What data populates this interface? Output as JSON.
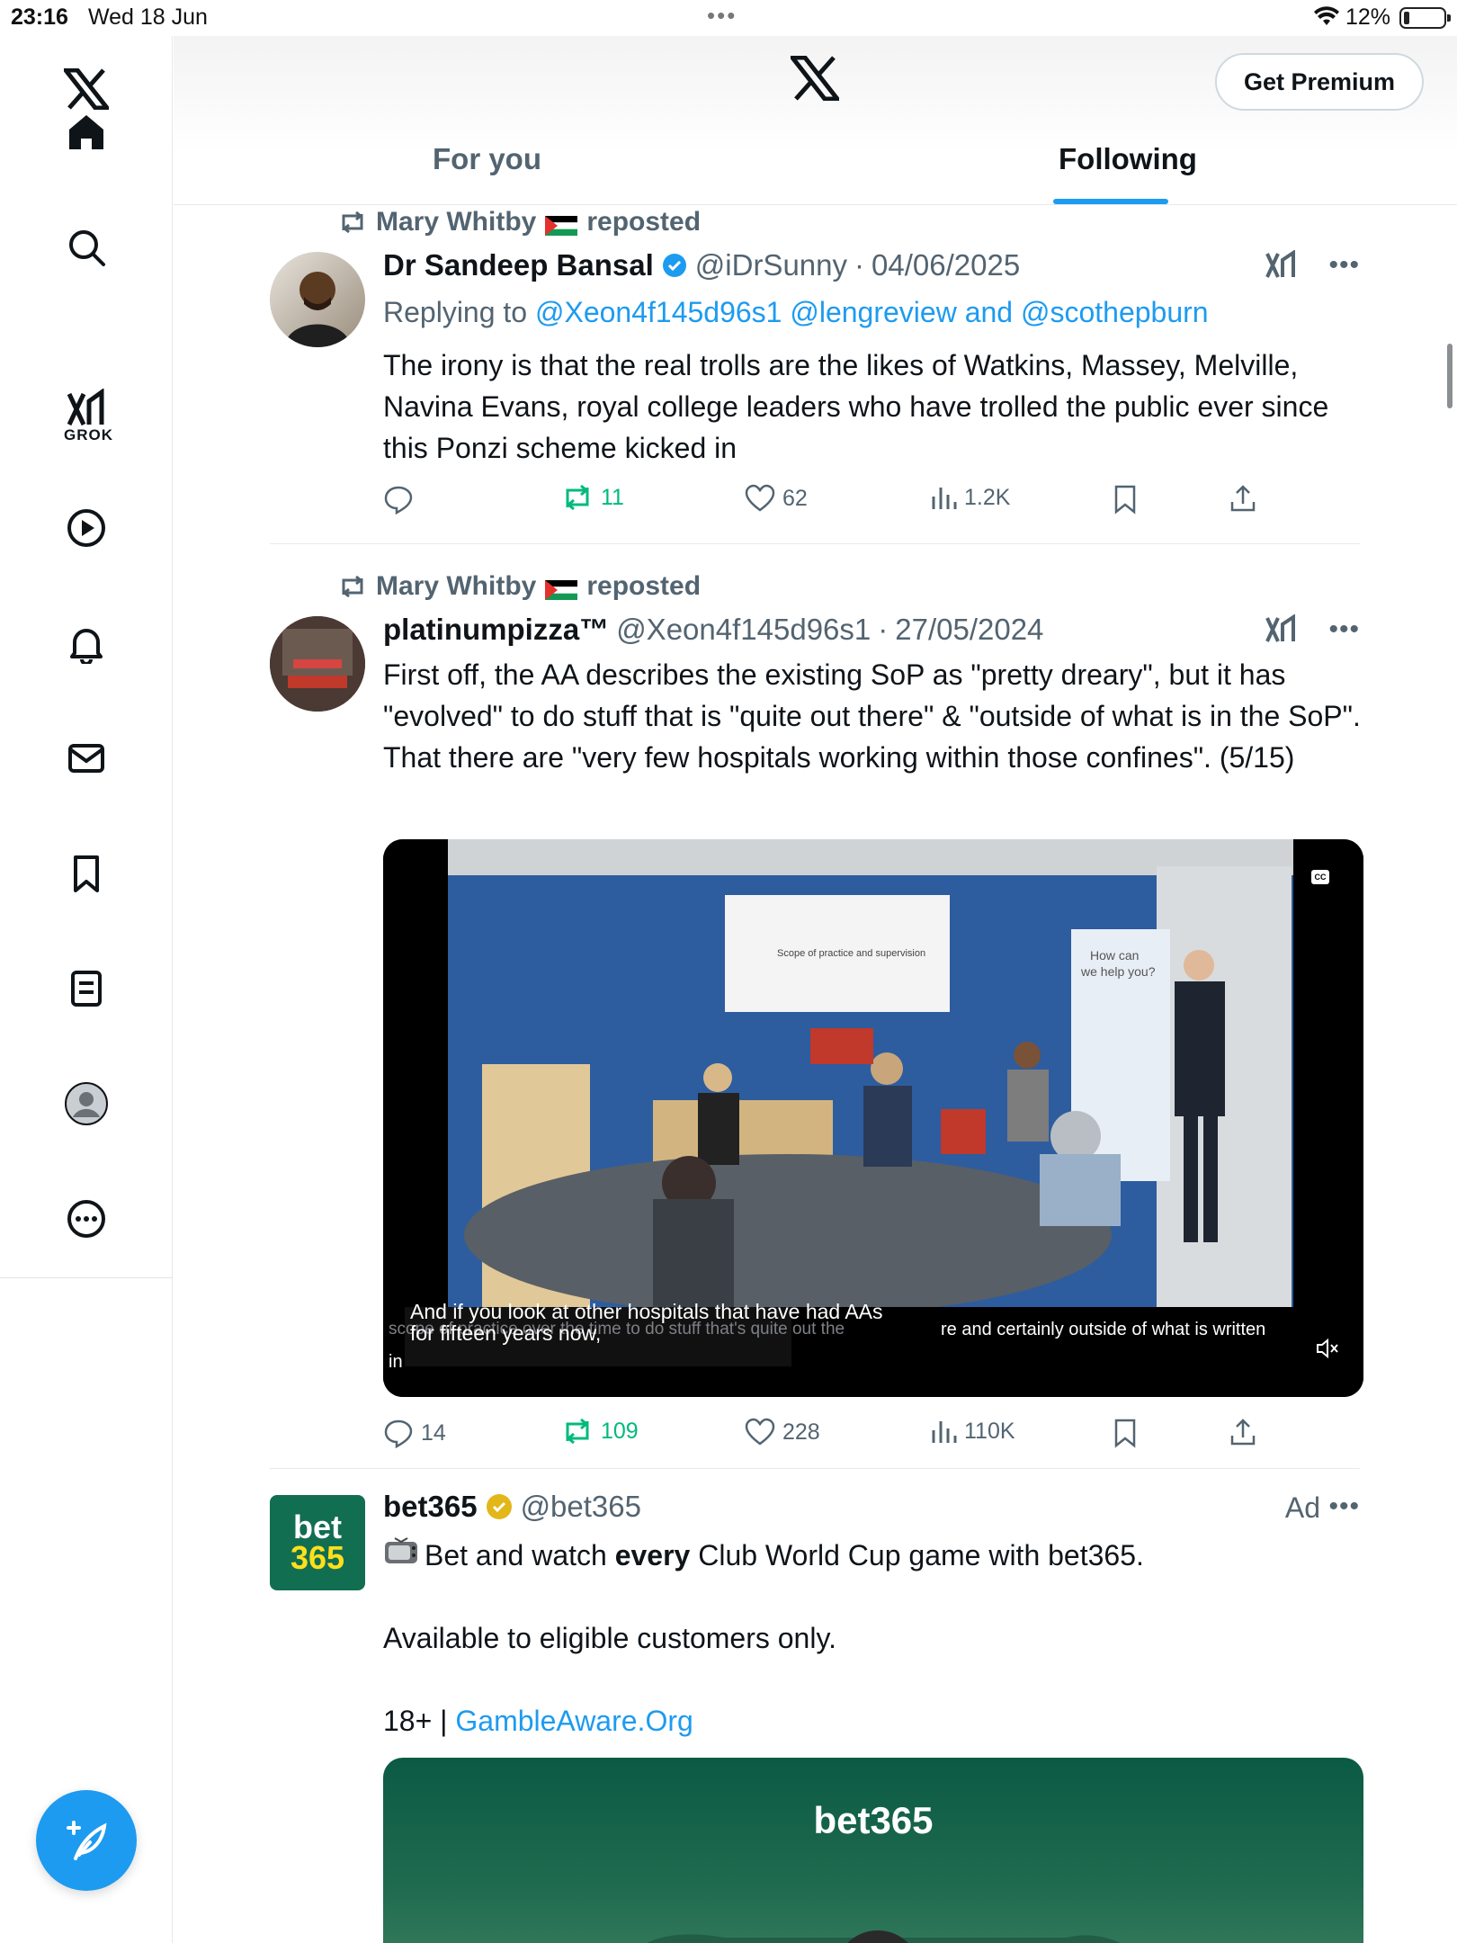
{
  "status_bar": {
    "time": "23:16",
    "date": "Wed 18 Jun",
    "battery": "12%"
  },
  "header": {
    "premium_label": "Get Premium",
    "tabs": [
      {
        "label": "For you"
      },
      {
        "label": "Following"
      }
    ]
  },
  "sidebar": {
    "grok_label": "GROK"
  },
  "tweets": [
    {
      "reposted_by": "Mary Whitby",
      "reposted_label": "reposted",
      "name": "Dr Sandeep Bansal",
      "handle": "@iDrSunny",
      "sep": "·",
      "date": "04/06/2025",
      "replying_label": "Replying to",
      "reply_to_1": "@Xeon4f145d96s1",
      "reply_to_2": "@lengreview",
      "reply_and": "and",
      "reply_to_3": "@scothepburn",
      "text": "The irony is that the real trolls are the likes of Watkins, Massey, Melville, Navina Evans, royal college leaders who have trolled the public ever since this Ponzi scheme kicked in",
      "stats": {
        "replies": "",
        "reposts": "11",
        "likes": "62",
        "views": "1.2K"
      }
    },
    {
      "reposted_by": "Mary Whitby",
      "reposted_label": "reposted",
      "name": "platinumpizza™",
      "handle": "@Xeon4f145d96s1",
      "sep": "·",
      "date": "27/05/2024",
      "text": "First off, the AA describes the existing SoP as \"pretty dreary\", but it has \"evolved\" to do stuff that is \"quite out there\" & \"outside of what is in the SoP\". That there are \"very few hospitals working within those confines\". (5/15)",
      "video": {
        "slide_title": "Scope of practice and supervision",
        "banner_text_1": "How can",
        "banner_text_2": "we help you?",
        "cc_label": "CC",
        "caption_1": "And if you look at other hospitals that have had AAs",
        "caption_2": "for fifteen years now,",
        "caption_bg_left": "scope of practice over the time to do stuff that's quite out the",
        "caption_bg_right": "re and certainly outside of what is written",
        "caption_bg_in": "in"
      },
      "stats": {
        "replies": "14",
        "reposts": "109",
        "likes": "228",
        "views": "110K"
      }
    },
    {
      "name": "bet365",
      "handle": "@bet365",
      "ad_label": "Ad",
      "text_pre": "Bet and watch",
      "text_bold": "every",
      "text_post": "Club World Cup game with bet365.",
      "text_line2": "Available to eligible customers only.",
      "text_line3_pre": "18+ |",
      "text_line3_link": "GambleAware.Org",
      "avatar_line1": "bet",
      "avatar_line2": "365",
      "banner_logo": "bet365"
    }
  ],
  "colors": {
    "accent": "#1d9bf0",
    "repost_green": "#00ba7c",
    "muted": "#536471",
    "bet365_green": "#126e51",
    "bet365_yellow": "#ffdf1b"
  }
}
